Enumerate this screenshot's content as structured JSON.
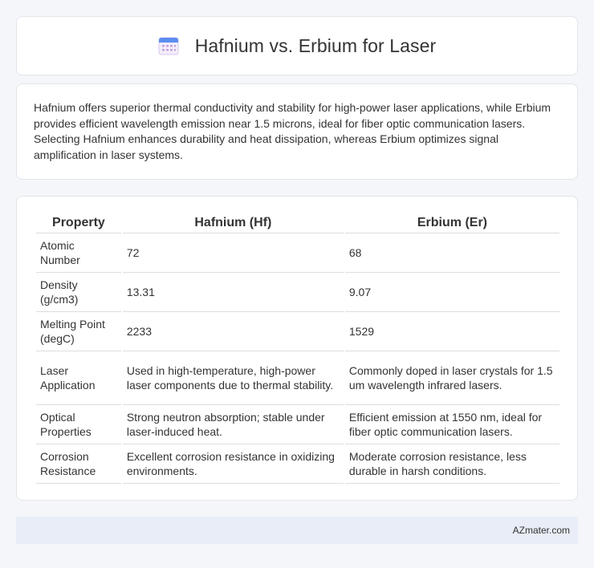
{
  "header": {
    "title": "Hafnium vs. Erbium for Laser",
    "icon": "calendar-icon",
    "icon_colors": {
      "top": "#5b8def",
      "grid": "#c9a0dc",
      "body": "#f3eefb"
    }
  },
  "intro": {
    "text": "Hafnium offers superior thermal conductivity and stability for high-power laser applications, while Erbium provides efficient wavelength emission near 1.5 microns, ideal for fiber optic communication lasers. Selecting Hafnium enhances durability and heat dissipation, whereas Erbium optimizes signal amplification in laser systems."
  },
  "table": {
    "headers": [
      "Property",
      "Hafnium (Hf)",
      "Erbium (Er)"
    ],
    "rows": [
      [
        "Atomic Number",
        "72",
        "68"
      ],
      [
        "Density (g/cm3)",
        "13.31",
        "9.07"
      ],
      [
        "Melting Point (degC)",
        "2233",
        "1529"
      ],
      [
        "Laser Application",
        "Used in high-temperature, high-power laser components due to thermal stability.",
        "Commonly doped in laser crystals for 1.5 um wavelength infrared lasers."
      ],
      [
        "Optical Properties",
        "Strong neutron absorption; stable under laser-induced heat.",
        "Efficient emission at 1550 nm, ideal for fiber optic communication lasers."
      ],
      [
        "Corrosion Resistance",
        "Excellent corrosion resistance in oxidizing environments.",
        "Moderate corrosion resistance, less durable in harsh conditions."
      ]
    ]
  },
  "footer": {
    "text": "AZmater.com"
  }
}
